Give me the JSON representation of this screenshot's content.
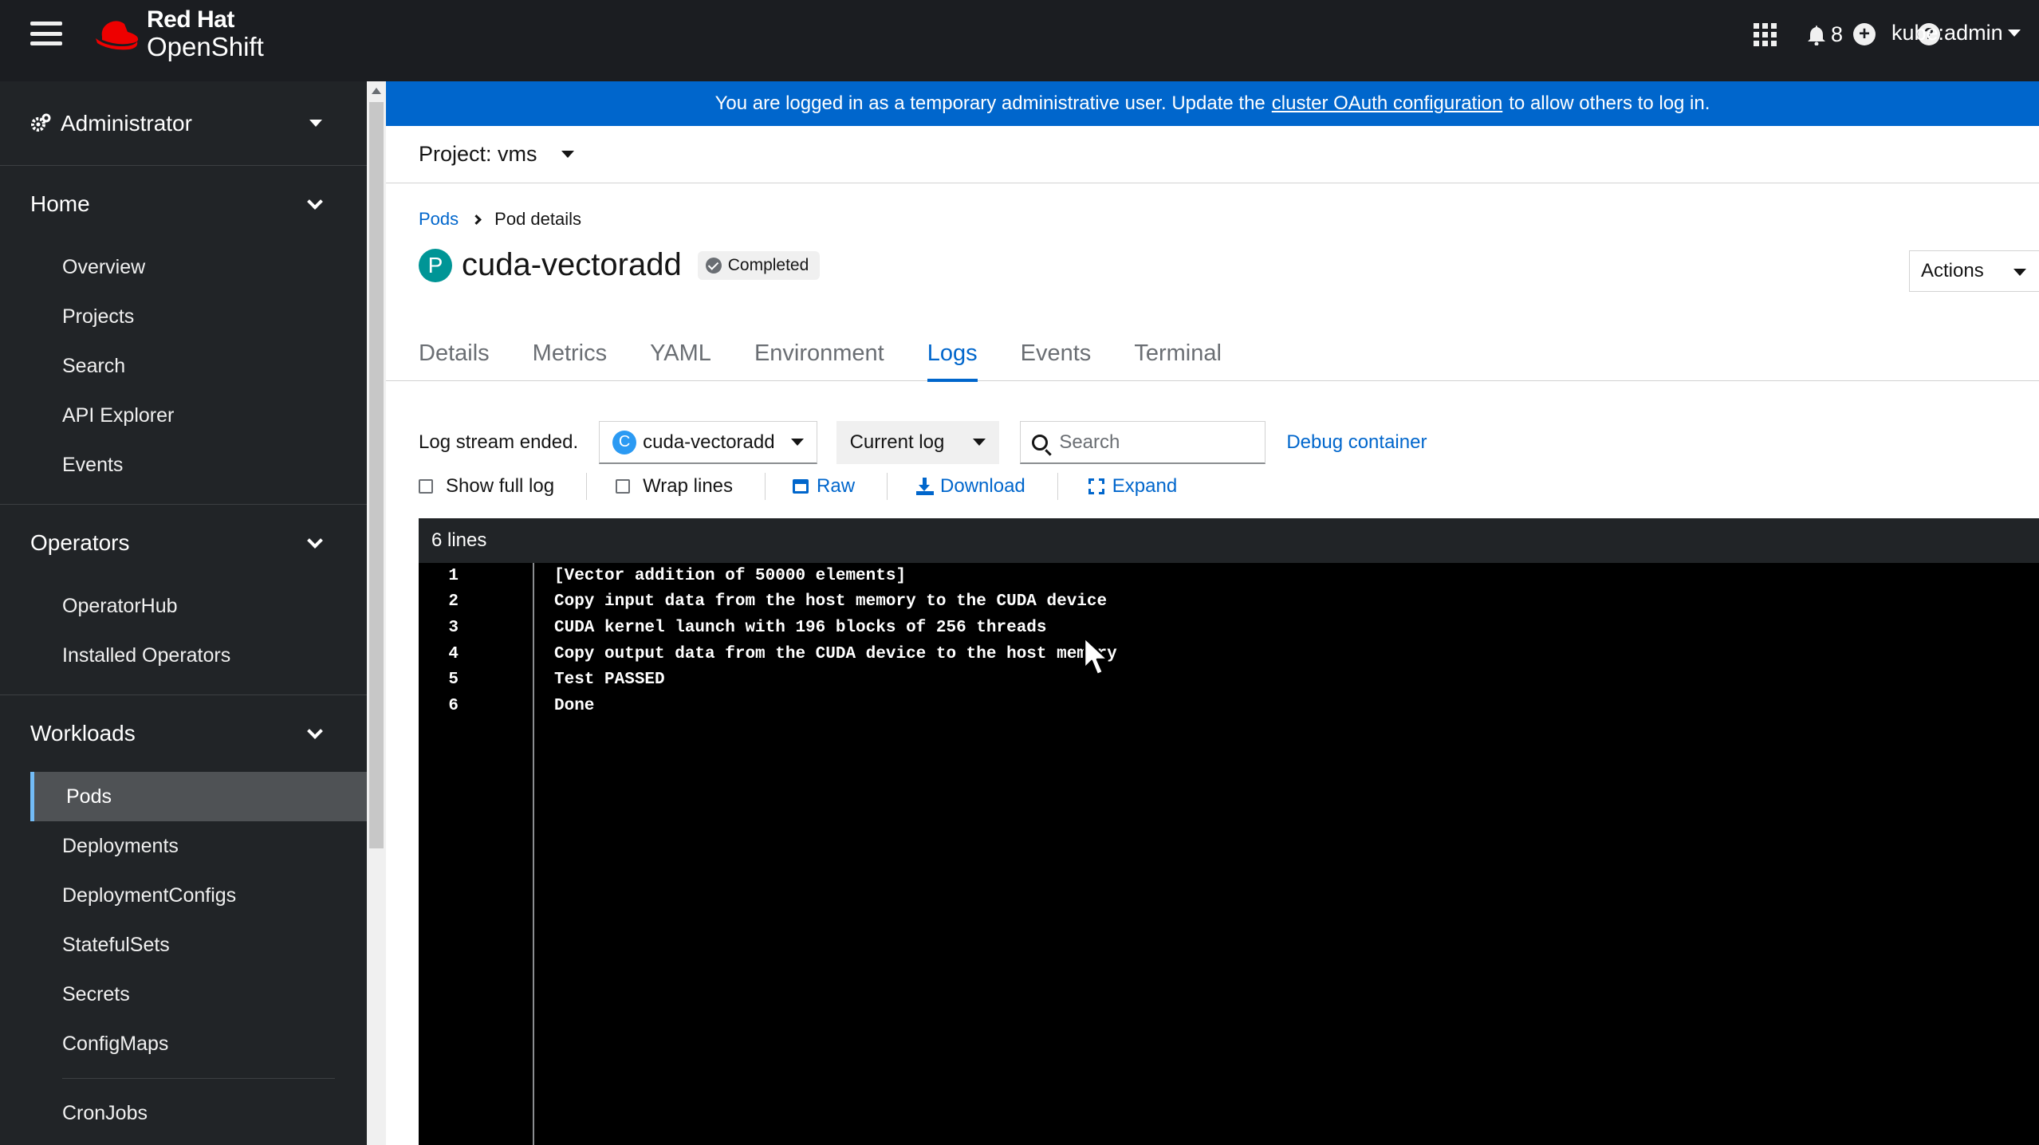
{
  "masthead": {
    "brand_line1": "Red Hat",
    "brand_line2": "OpenShift",
    "notifications_count": "8",
    "user": "kube:admin"
  },
  "sidebar": {
    "perspective": "Administrator",
    "sections": [
      {
        "title": "Home",
        "items": [
          "Overview",
          "Projects",
          "Search",
          "API Explorer",
          "Events"
        ]
      },
      {
        "title": "Operators",
        "items": [
          "OperatorHub",
          "Installed Operators"
        ]
      },
      {
        "title": "Workloads",
        "items": [
          "Pods",
          "Deployments",
          "DeploymentConfigs",
          "StatefulSets",
          "Secrets",
          "ConfigMaps",
          "CronJobs"
        ]
      }
    ],
    "active_item": "Pods"
  },
  "banner": {
    "prefix": "You are logged in as a temporary administrative user. Update the",
    "link": "cluster OAuth configuration",
    "suffix": "to allow others to log in."
  },
  "project": {
    "label": "Project: vms"
  },
  "breadcrumb": {
    "parent": "Pods",
    "current": "Pod details"
  },
  "pod": {
    "badge": "P",
    "name": "cuda-vectoradd",
    "status": "Completed"
  },
  "actions_label": "Actions",
  "tabs": [
    "Details",
    "Metrics",
    "YAML",
    "Environment",
    "Logs",
    "Events",
    "Terminal"
  ],
  "active_tab": "Logs",
  "log_toolbar": {
    "stream_status": "Log stream ended.",
    "container_badge": "C",
    "container": "cuda-vectoradd",
    "log_type": "Current log",
    "search_placeholder": "Search",
    "debug_label": "Debug container",
    "show_full_log": "Show full log",
    "wrap_lines": "Wrap lines",
    "raw": "Raw",
    "download": "Download",
    "expand": "Expand"
  },
  "log": {
    "line_count_label": "6 lines",
    "lines": [
      {
        "num": "1",
        "text": "[Vector addition of 50000 elements]"
      },
      {
        "num": "2",
        "text": "Copy input data from the host memory to the CUDA device"
      },
      {
        "num": "3",
        "text": "CUDA kernel launch with 196 blocks of 256 threads"
      },
      {
        "num": "4",
        "text": "Copy output data from the CUDA device to the host memory"
      },
      {
        "num": "5",
        "text": "Test PASSED"
      },
      {
        "num": "6",
        "text": "Done"
      }
    ]
  },
  "colors": {
    "masthead": "#1b1d21",
    "sidebar": "#212427",
    "banner": "#0066cc",
    "link": "#0066cc",
    "pod_badge": "#009596",
    "container_badge": "#2b9af3"
  }
}
